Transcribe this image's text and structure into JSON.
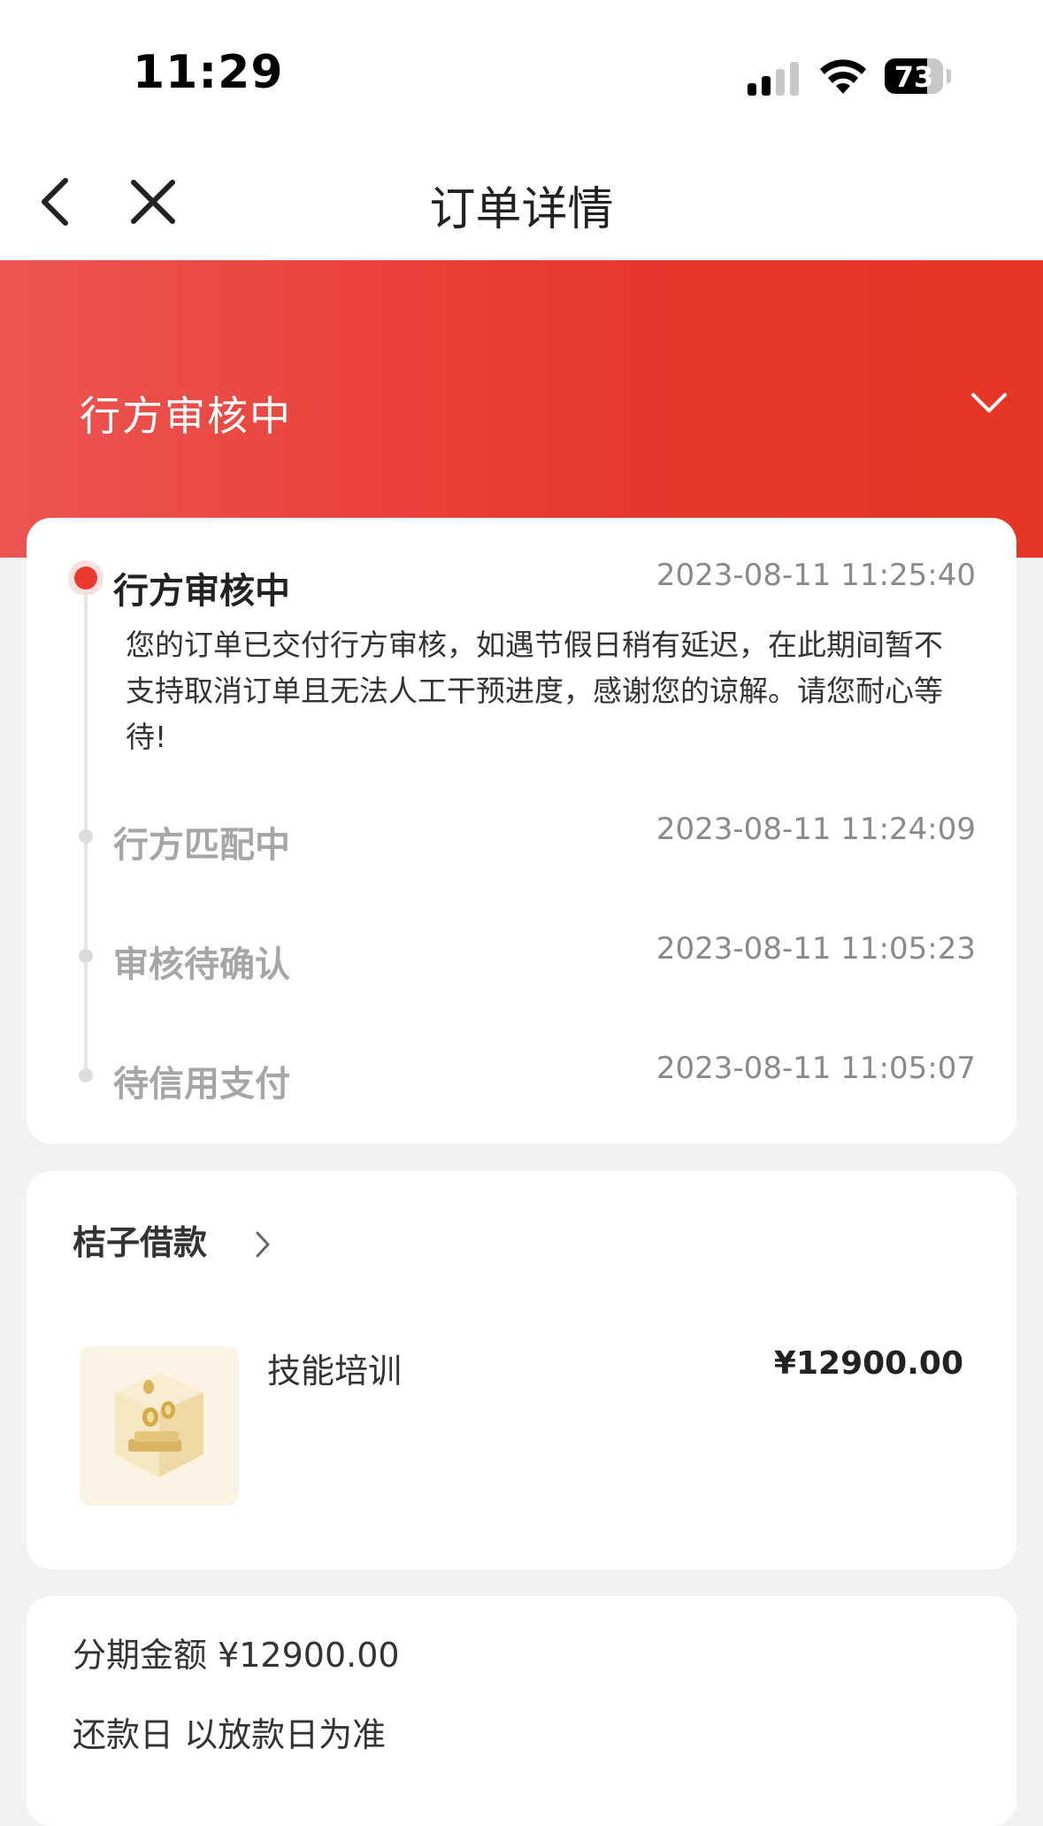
{
  "status_bar": {
    "time": "11:29",
    "battery": "73",
    "battery_level": 0.73
  },
  "nav": {
    "title": "订单详情",
    "back_icon": "chevron-left-icon",
    "close_icon": "close-icon"
  },
  "header": {
    "status": "行方审核中",
    "toggle_icon": "chevron-down-icon"
  },
  "timeline": [
    {
      "title": "行方审核中",
      "time": "2023-08-11 11:25:40",
      "active": true,
      "description": "您的订单已交付行方审核，如遇节假日稍有延迟，在此期间暂不支持取消订单且无法人工干预进度，感谢您的谅解。请您耐心等待!"
    },
    {
      "title": "行方匹配中",
      "time": "2023-08-11 11:24:09",
      "active": false
    },
    {
      "title": "审核待确认",
      "time": "2023-08-11 11:05:23",
      "active": false
    },
    {
      "title": "待信用支付",
      "time": "2023-08-11 11:05:07",
      "active": false
    }
  ],
  "merchant": {
    "name": "桔子借款",
    "icon": "chevron-right-icon"
  },
  "product": {
    "name": "技能培训",
    "price": "¥12900.00",
    "thumbnail": "coins-box-image"
  },
  "info": {
    "installment_amount": "分期金额 ¥12900.00",
    "repayment_day": "还款日 以放款日为准"
  },
  "colors": {
    "accent": "#e8392f",
    "header_gradient_start": "#ec5552",
    "header_gradient_end": "#e63524",
    "background": "#f2f2f2"
  }
}
